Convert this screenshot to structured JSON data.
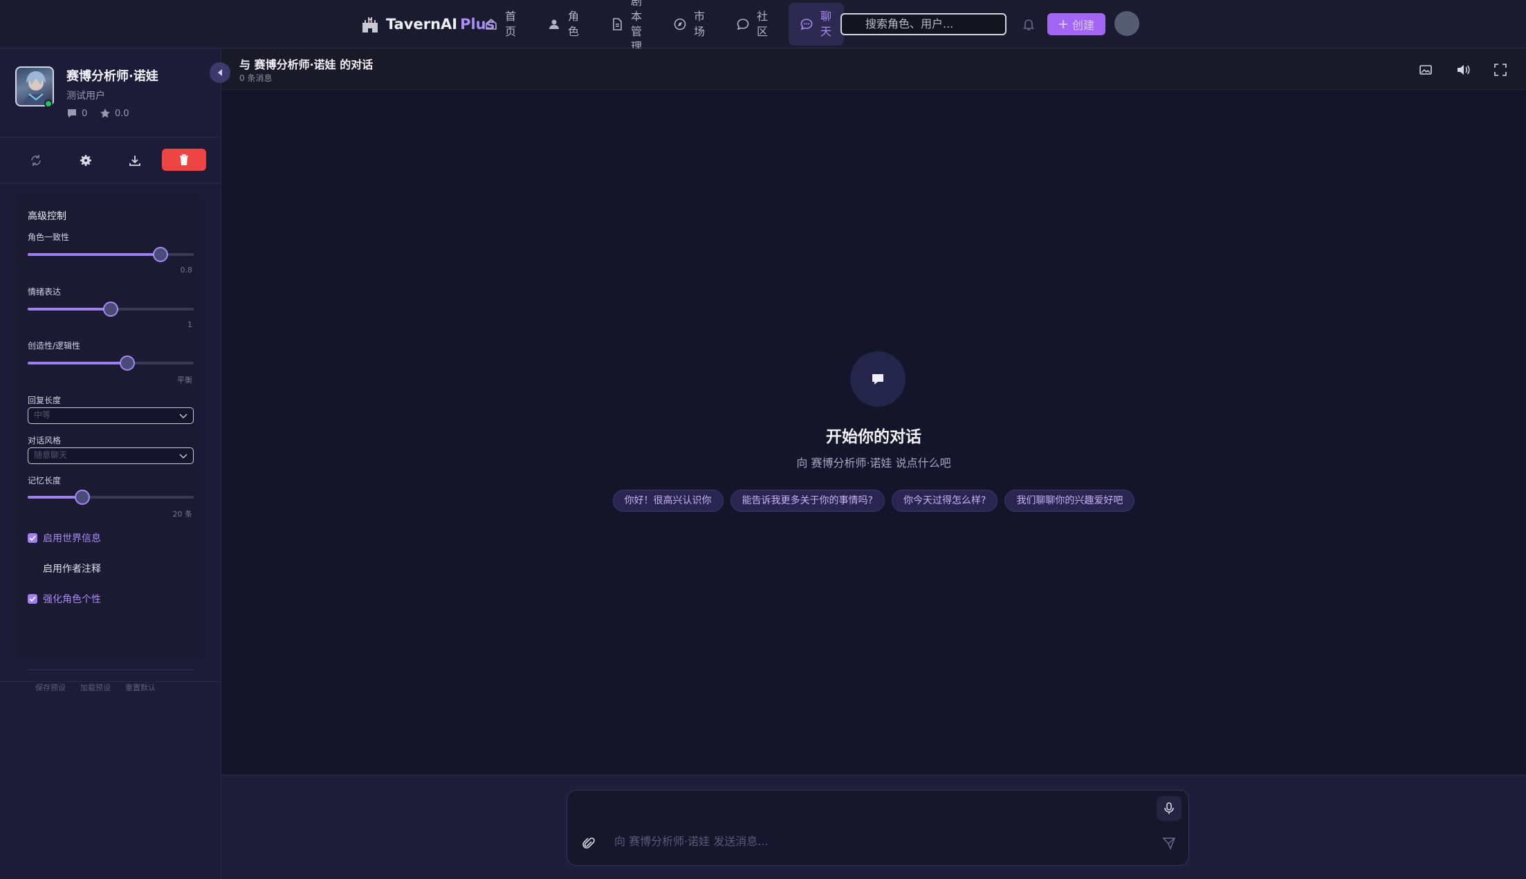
{
  "app": {
    "brand_name": "TavernAI",
    "brand_plus": "Plus",
    "accent": "#a17ff2",
    "danger": "#ef4444",
    "online": "#22c55e"
  },
  "nav": {
    "items": [
      {
        "label": "首页",
        "icon": "home-icon"
      },
      {
        "label": "角色",
        "icon": "user-icon"
      },
      {
        "label": "剧本管理",
        "icon": "document-icon"
      },
      {
        "label": "市场",
        "icon": "compass-icon"
      },
      {
        "label": "社区",
        "icon": "message-circle-icon"
      },
      {
        "label": "聊天",
        "icon": "chat-icon",
        "active": true
      }
    ],
    "search_placeholder": "搜索角色、用户...",
    "create_label": "创建"
  },
  "character": {
    "name": "赛博分析师·诺娃",
    "creator": "测试用户",
    "messages": "0",
    "rating": "0.0",
    "status": "online"
  },
  "controls": {
    "title": "高级控制",
    "consistency": {
      "label": "角色一致性",
      "value": 0.8,
      "display": "0.8"
    },
    "emotion": {
      "label": "情绪表达",
      "value": 0.5,
      "display": "1"
    },
    "creativity": {
      "label": "创造性/逻辑性",
      "value": 0.6,
      "display": "平衡"
    },
    "reply_length": {
      "label": "回复长度",
      "selected": "中等"
    },
    "style": {
      "label": "对话风格",
      "selected": "随意聊天"
    },
    "memory": {
      "label": "记忆长度",
      "value": 0.33,
      "display": "20 条"
    },
    "world_info": {
      "label": "启用世界信息",
      "checked": true
    },
    "author_note": {
      "label": "启用作者注释",
      "checked": false
    },
    "personality": {
      "label": "强化角色个性",
      "checked": true
    },
    "save_preset": "保存预设",
    "load_preset": "加载预设",
    "reset": "重置默认"
  },
  "chat": {
    "title": "与 赛博分析师·诺娃 的对话",
    "message_count": "0 条消息",
    "empty_title": "开始你的对话",
    "empty_subtitle": "向 赛博分析师·诺娃 说点什么吧",
    "suggestions": [
      "你好！很高兴认识你",
      "能告诉我更多关于你的事情吗?",
      "你今天过得怎么样?",
      "我们聊聊你的兴趣爱好吧"
    ],
    "input_placeholder": "向 赛博分析师·诺娃 发送消息..."
  }
}
